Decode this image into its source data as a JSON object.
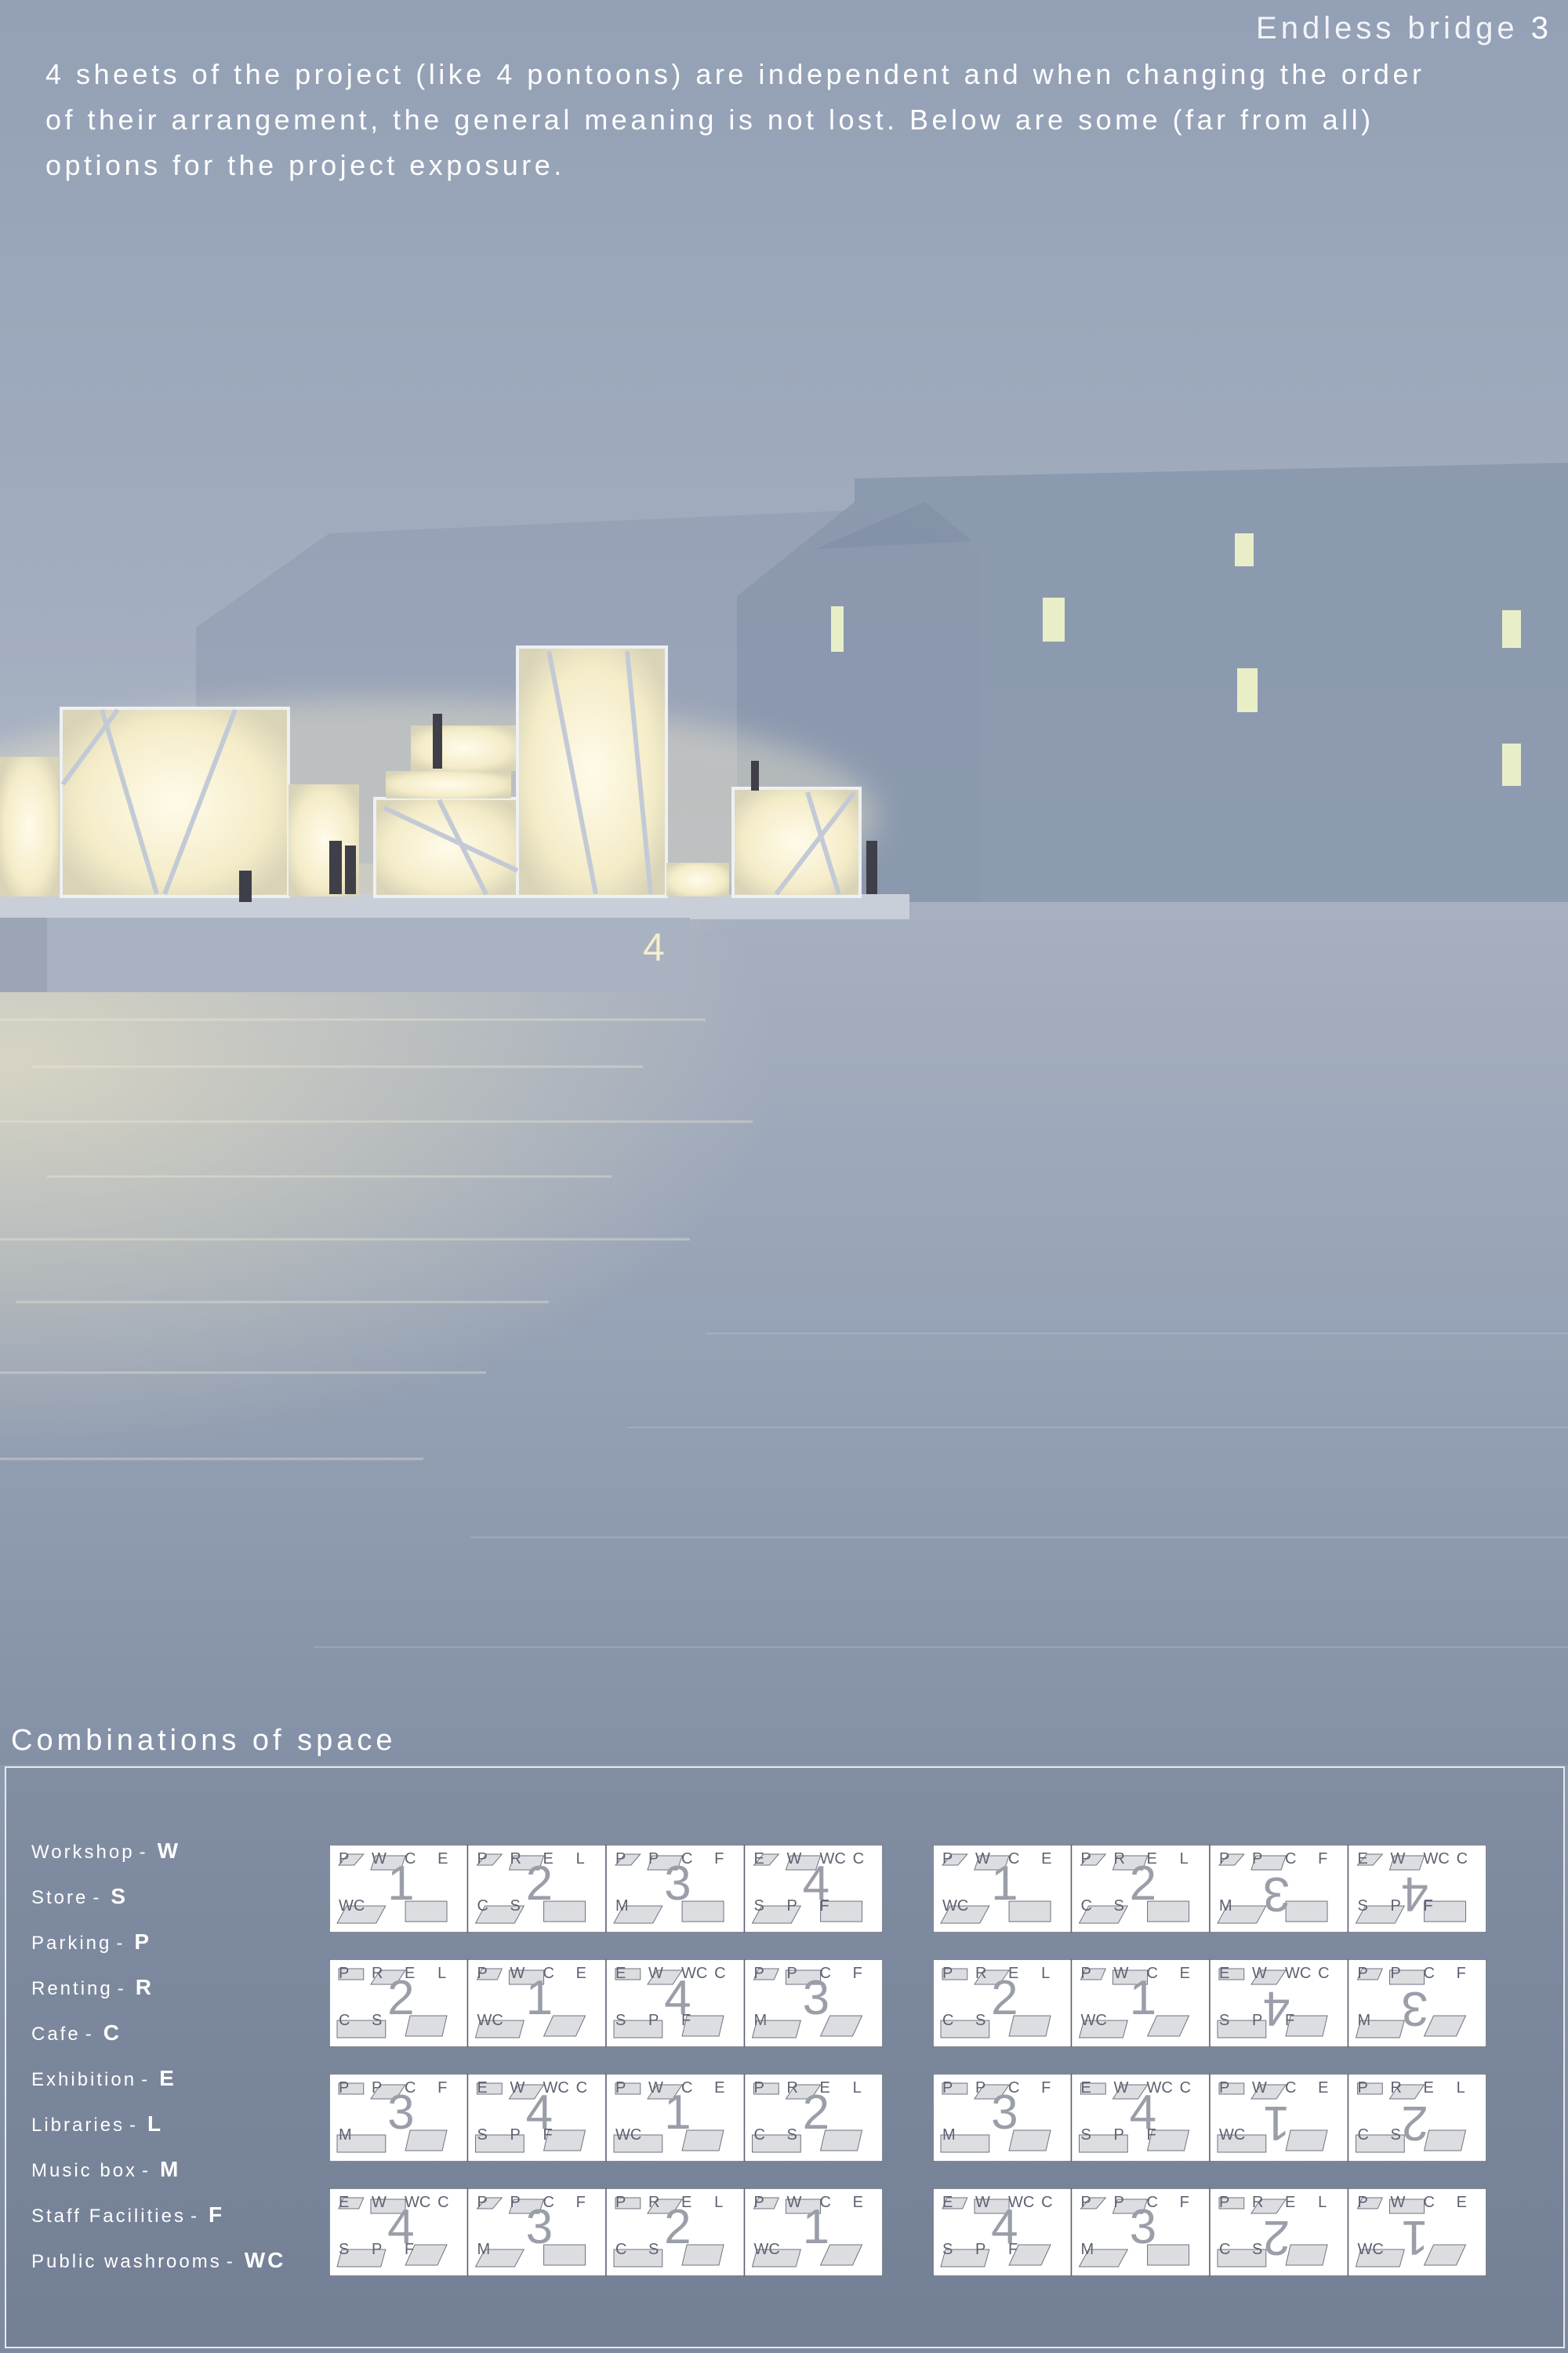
{
  "poster": {
    "title": "Endless bridge",
    "title_number": "3",
    "intro_lines": [
      "4 sheets of the project (like 4 pontoons) are independent and when changing the order",
      "of their arrangement, the general meaning is not lost. Below are some (far from all)",
      "options for the project exposure."
    ],
    "pontoon_label": "4"
  },
  "combinations": {
    "section_title": "Combinations of space",
    "legend": [
      {
        "name": "Workshop",
        "code": "W"
      },
      {
        "name": "Store",
        "code": "S"
      },
      {
        "name": "Parking",
        "code": "P"
      },
      {
        "name": "Renting",
        "code": "R"
      },
      {
        "name": "Cafe",
        "code": "C"
      },
      {
        "name": "Exhibition",
        "code": "E"
      },
      {
        "name": "Libraries",
        "code": "L"
      },
      {
        "name": "Music box",
        "code": "M"
      },
      {
        "name": "Staff Facilities",
        "code": "F"
      },
      {
        "name": "Public washrooms",
        "code": "WC"
      }
    ],
    "left_column": [
      {
        "order": [
          "1",
          "2",
          "3",
          "4"
        ]
      },
      {
        "order": [
          "2",
          "1",
          "4",
          "3"
        ]
      },
      {
        "order": [
          "3",
          "4",
          "1",
          "2"
        ]
      },
      {
        "order": [
          "4",
          "3",
          "2",
          "1"
        ]
      }
    ],
    "right_column": [
      {
        "order": [
          "1",
          "2",
          "3",
          "4"
        ]
      },
      {
        "order": [
          "2",
          "1",
          "4",
          "3"
        ]
      },
      {
        "order": [
          "3",
          "4",
          "1",
          "2"
        ]
      },
      {
        "order": [
          "4",
          "3",
          "2",
          "1"
        ]
      }
    ],
    "sheet_letters": {
      "1": [
        "P",
        "W",
        "C",
        "E",
        "WC"
      ],
      "2": [
        "P",
        "R",
        "E",
        "L",
        "C",
        "S"
      ],
      "3": [
        "P",
        "P",
        "C",
        "F",
        "M"
      ],
      "4": [
        "E",
        "W",
        "WC",
        "C",
        "S",
        "P",
        "F"
      ]
    }
  },
  "colors": {
    "plan_fill": "#ffffff",
    "room_fill": "#dcdde0",
    "glow": "#fff6d8",
    "water": "#8e9ab0"
  }
}
